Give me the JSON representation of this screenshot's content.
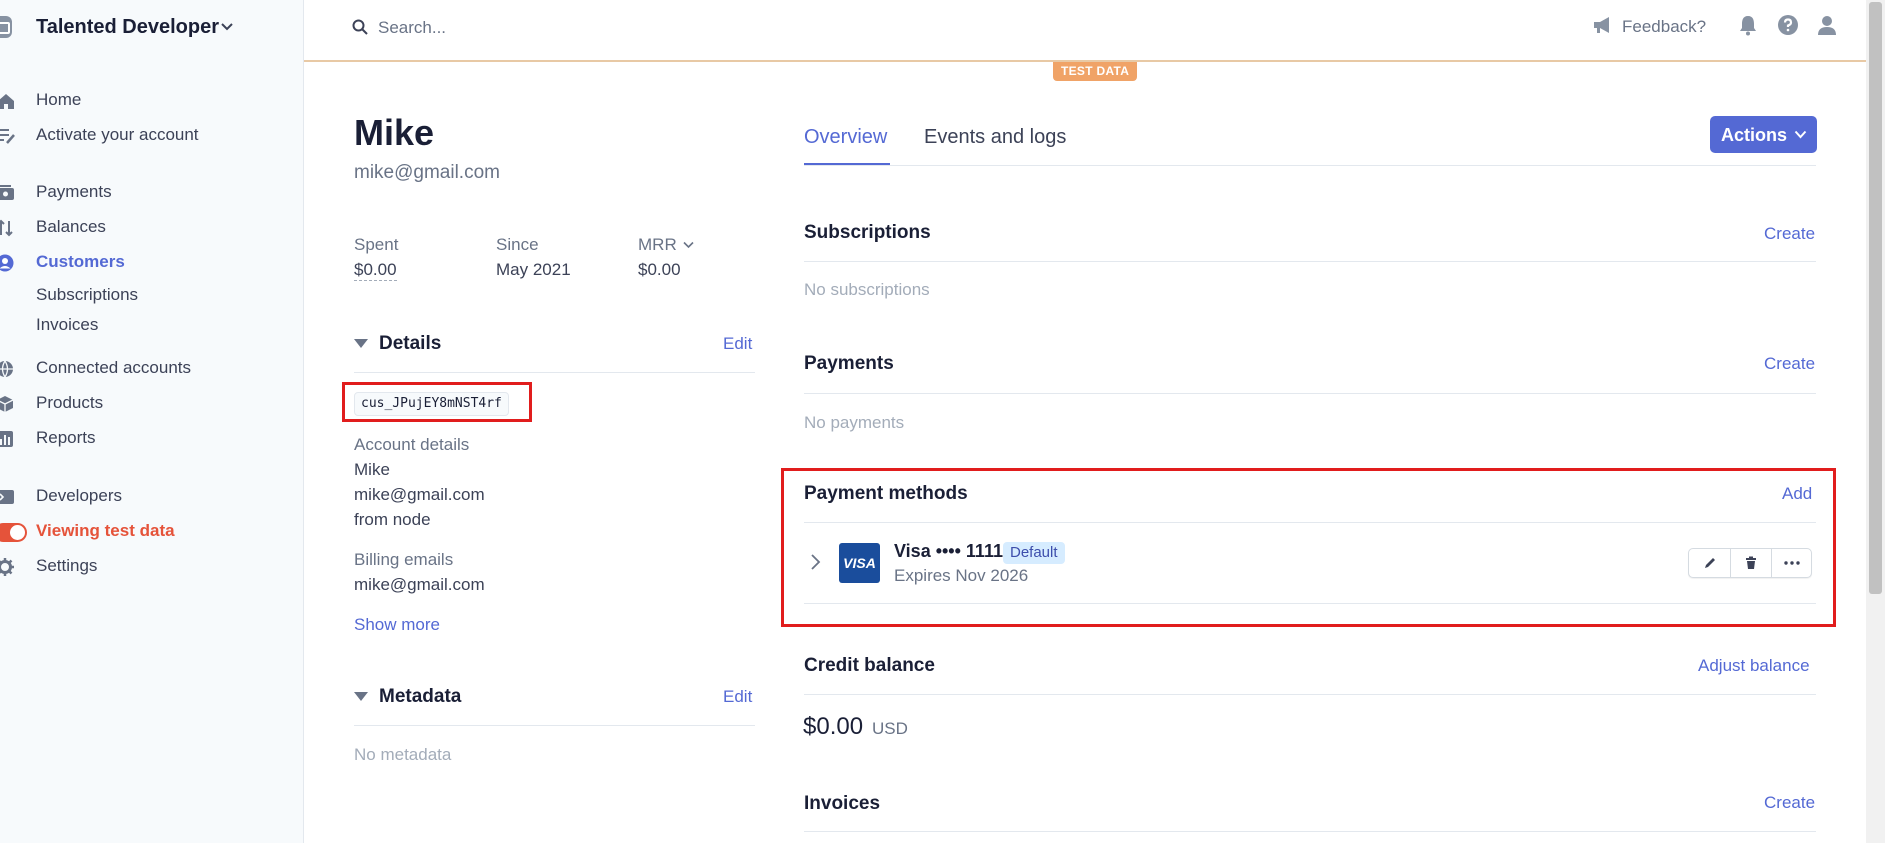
{
  "sidebar": {
    "account_name": "Talented Developer",
    "nav": {
      "home": "Home",
      "activate": "Activate your account",
      "payments": "Payments",
      "balances": "Balances",
      "customers": "Customers",
      "subscriptions": "Subscriptions",
      "invoices": "Invoices",
      "connected": "Connected accounts",
      "products": "Products",
      "reports": "Reports",
      "developers": "Developers",
      "test_data": "Viewing test data",
      "settings": "Settings"
    }
  },
  "topbar": {
    "search_placeholder": "Search...",
    "feedback": "Feedback?",
    "test_badge": "TEST DATA"
  },
  "customer": {
    "name": "Mike",
    "email": "mike@gmail.com",
    "stats": {
      "spent_label": "Spent",
      "spent_value": "$0.00",
      "since_label": "Since",
      "since_value": "May 2021",
      "mrr_label": "MRR",
      "mrr_value": "$0.00"
    },
    "details": {
      "title": "Details",
      "edit": "Edit",
      "id": "cus_JPujEY8mNST4rf",
      "account_label": "Account details",
      "account_name": "Mike",
      "account_email": "mike@gmail.com",
      "account_desc": "from node",
      "billing_label": "Billing emails",
      "billing_email": "mike@gmail.com",
      "show_more": "Show more"
    },
    "metadata": {
      "title": "Metadata",
      "edit": "Edit",
      "empty": "No metadata"
    }
  },
  "main": {
    "tabs": {
      "overview": "Overview",
      "events": "Events and logs"
    },
    "actions_label": "Actions",
    "subscriptions": {
      "title": "Subscriptions",
      "action": "Create",
      "empty": "No subscriptions"
    },
    "payments": {
      "title": "Payments",
      "action": "Create",
      "empty": "No payments"
    },
    "payment_methods": {
      "title": "Payment methods",
      "action": "Add",
      "card": {
        "brand_logo": "VISA",
        "title": "Visa •••• 1111",
        "badge": "Default",
        "expires": "Expires Nov 2026"
      }
    },
    "credit_balance": {
      "title": "Credit balance",
      "action": "Adjust balance",
      "amount": "$0.00",
      "currency": "USD"
    },
    "invoices": {
      "title": "Invoices",
      "action": "Create"
    }
  },
  "colors": {
    "accent": "#5469d4",
    "highlight": "#e11d1d",
    "test_mode": "#e5533a",
    "test_badge": "#f0a367"
  }
}
